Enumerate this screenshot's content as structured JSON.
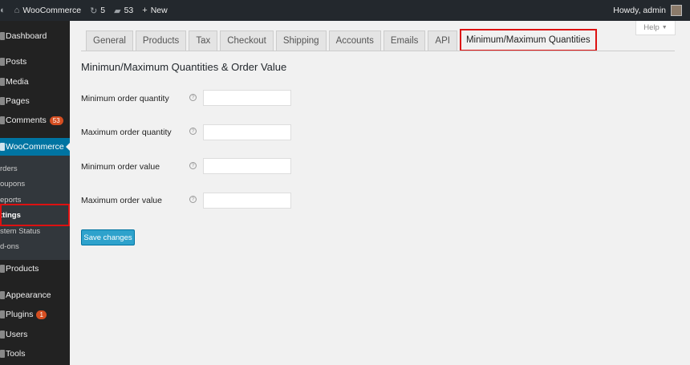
{
  "adminbar": {
    "site_name": "WooCommerce",
    "updates_count": "5",
    "comments_count": "53",
    "new_label": "New",
    "greeting": "Howdy, admin"
  },
  "sidebar": {
    "items": [
      {
        "label": "Dashboard"
      },
      {
        "label": "Posts"
      },
      {
        "label": "Media"
      },
      {
        "label": "Pages"
      },
      {
        "label": "Comments",
        "badge": "53"
      },
      {
        "label": "WooCommerce"
      },
      {
        "label": "Products"
      },
      {
        "label": "Appearance"
      },
      {
        "label": "Plugins",
        "badge": "1"
      },
      {
        "label": "Users"
      },
      {
        "label": "Tools"
      }
    ],
    "submenu": [
      "rders",
      "oupons",
      "eports",
      "ttings",
      "stem Status",
      "d-ons"
    ]
  },
  "help_tab": {
    "label": "Help"
  },
  "tabs": [
    "General",
    "Products",
    "Tax",
    "Checkout",
    "Shipping",
    "Accounts",
    "Emails",
    "API",
    "Minimum/Maximum Quantities"
  ],
  "main": {
    "heading": "Minimun/Maximum Quantities & Order Value",
    "fields": [
      {
        "label": "Minimum order quantity",
        "value": ""
      },
      {
        "label": "Maximum order quantity",
        "value": ""
      },
      {
        "label": "Minimum order value",
        "value": ""
      },
      {
        "label": "Maximum order value",
        "value": ""
      }
    ],
    "save_label": "Save changes"
  },
  "colors": {
    "adminbar_bg": "#23282d",
    "sidebar_bg": "#222222",
    "active_menu": "#0074a2",
    "highlight_box": "#dd1111",
    "button": "#2ea2cc",
    "badge": "#d54e21"
  },
  "icons": [
    "wordpress-icon",
    "home-icon",
    "updates-icon",
    "comment-icon",
    "plus-icon",
    "help-icon",
    "chevron-down-icon",
    "avatar"
  ]
}
